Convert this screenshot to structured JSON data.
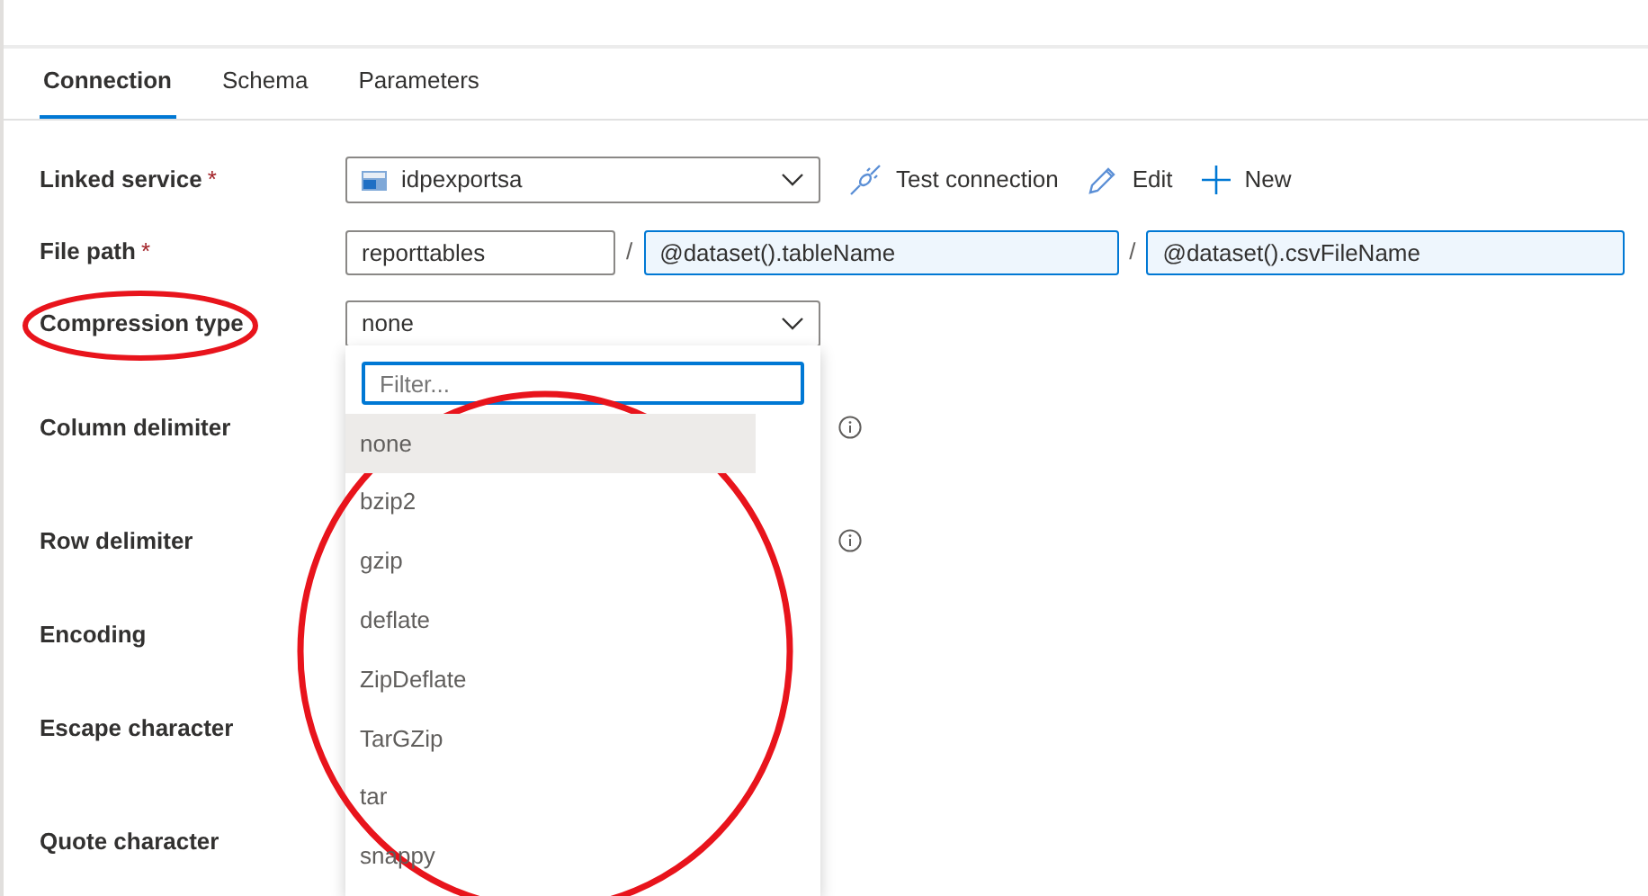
{
  "tabs": [
    {
      "label": "Connection",
      "selected": true
    },
    {
      "label": "Schema",
      "selected": false
    },
    {
      "label": "Parameters",
      "selected": false
    }
  ],
  "linked_service": {
    "label": "Linked service",
    "required_mark": "*",
    "value": "idpexportsa",
    "actions": [
      {
        "kind": "test",
        "label": "Test connection"
      },
      {
        "kind": "edit",
        "label": "Edit"
      },
      {
        "kind": "new",
        "label": "New"
      }
    ]
  },
  "file_path": {
    "label": "File path",
    "required_mark": "*",
    "segments": [
      {
        "value": "reporttables",
        "dynamic": false
      },
      {
        "value": "@dataset().tableName",
        "dynamic": true
      },
      {
        "value": "@dataset().csvFileName",
        "dynamic": true
      }
    ],
    "separators": [
      "/",
      "/"
    ]
  },
  "compression_type": {
    "label": "Compression type",
    "value": "none",
    "expanded": true,
    "filter_placeholder": "Filter...",
    "options": [
      {
        "label": "none",
        "selected": true
      },
      {
        "label": "bzip2",
        "selected": false
      },
      {
        "label": "gzip",
        "selected": false
      },
      {
        "label": "deflate",
        "selected": false
      },
      {
        "label": "ZipDeflate",
        "selected": false
      },
      {
        "label": "TarGZip",
        "selected": false
      },
      {
        "label": "tar",
        "selected": false
      },
      {
        "label": "snappy",
        "selected": false
      }
    ]
  },
  "other_fields": [
    {
      "label": "Column delimiter",
      "info": true
    },
    {
      "label": "Row delimiter",
      "info": true
    },
    {
      "label": "Encoding",
      "info": false
    },
    {
      "label": "Escape character",
      "info": false
    },
    {
      "label": "Quote character",
      "info": false
    }
  ]
}
